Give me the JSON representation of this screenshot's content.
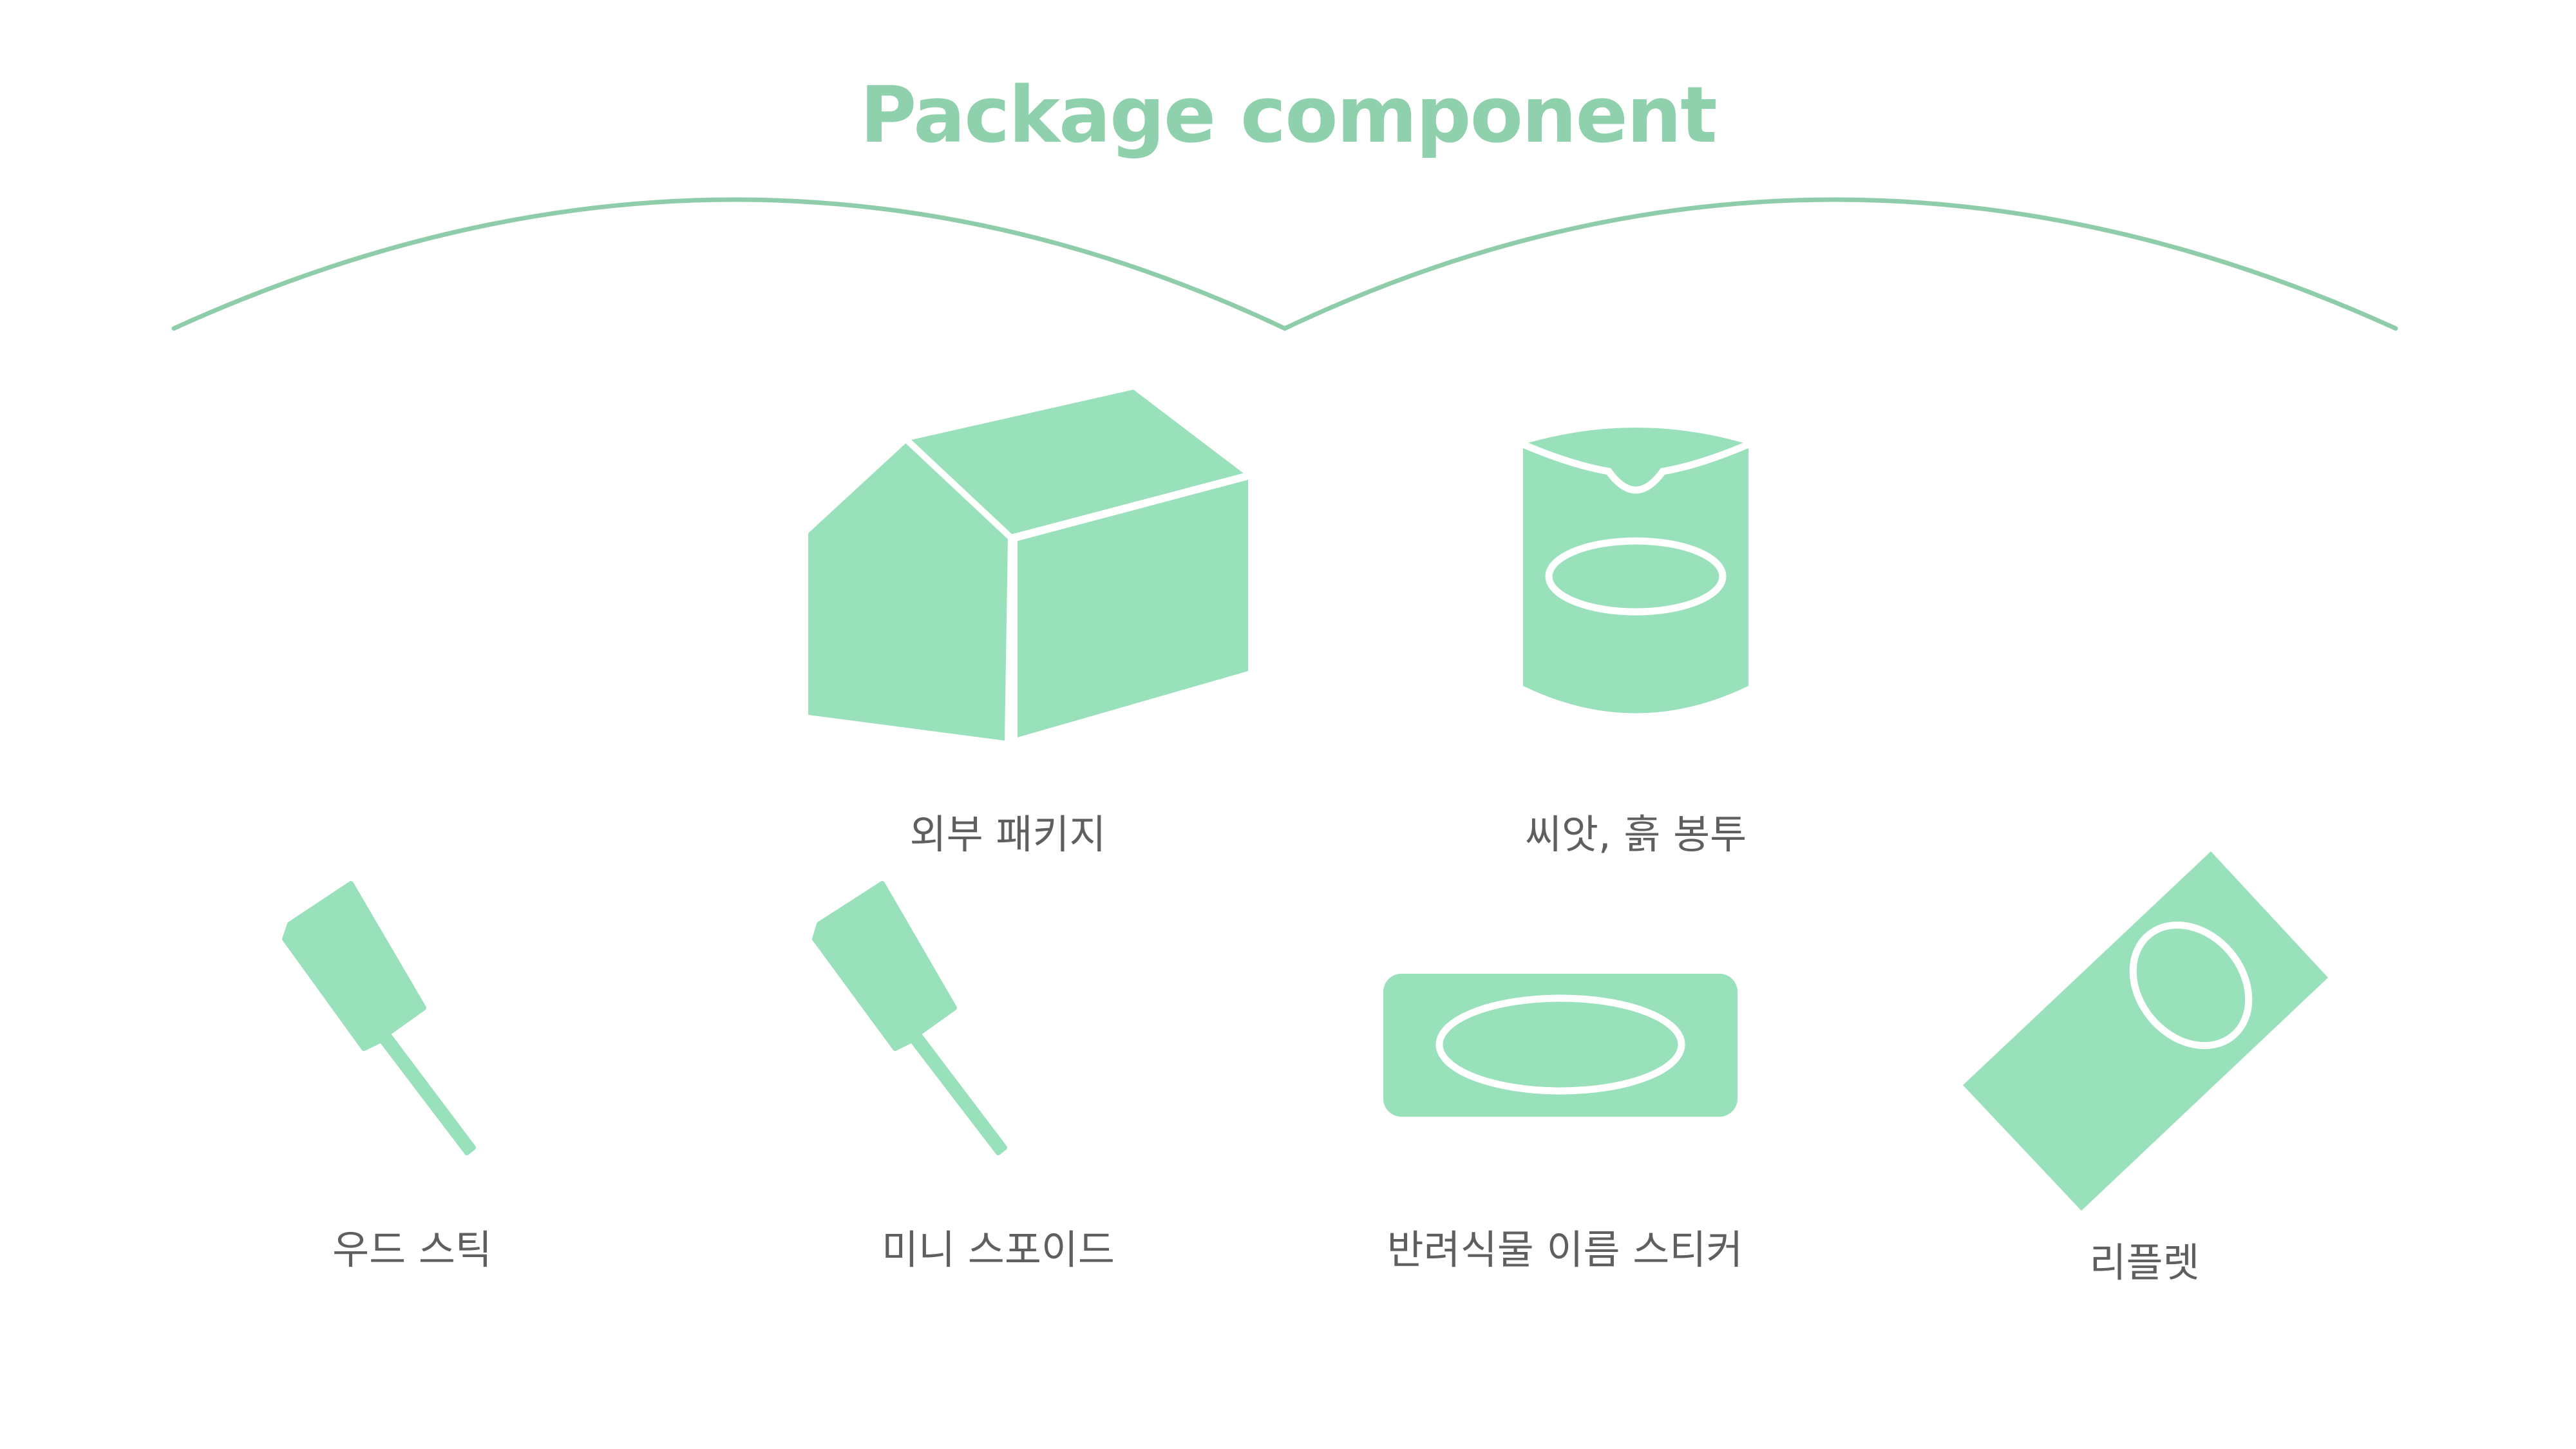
{
  "title": "Package component",
  "colors": {
    "accent": "#98e1ba",
    "title": "#8fd1ad",
    "arc": "#8fcdaa",
    "label": "#5f5f5f"
  },
  "components": [
    {
      "label": "외부 패키지",
      "icon": "box-icon"
    },
    {
      "label": "씨앗, 흙 봉투",
      "icon": "pouch-icon"
    },
    {
      "label": "우드 스틱",
      "icon": "wood-stick-icon"
    },
    {
      "label": "미니 스포이드",
      "icon": "mini-dropper-icon"
    },
    {
      "label": "반려식물 이름 스티커",
      "icon": "name-sticker-icon"
    },
    {
      "label": "리플렛",
      "icon": "leaflet-icon"
    }
  ]
}
